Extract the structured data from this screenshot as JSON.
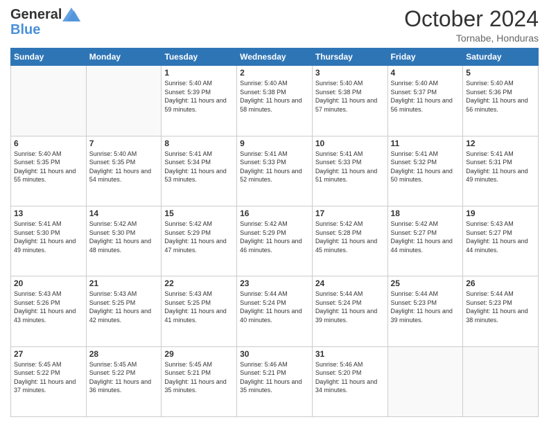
{
  "header": {
    "logo_general": "General",
    "logo_blue": "Blue",
    "month": "October 2024",
    "location": "Tornabe, Honduras"
  },
  "days_of_week": [
    "Sunday",
    "Monday",
    "Tuesday",
    "Wednesday",
    "Thursday",
    "Friday",
    "Saturday"
  ],
  "weeks": [
    [
      {
        "day": "",
        "content": ""
      },
      {
        "day": "",
        "content": ""
      },
      {
        "day": "1",
        "content": "Sunrise: 5:40 AM\nSunset: 5:39 PM\nDaylight: 11 hours and 59 minutes."
      },
      {
        "day": "2",
        "content": "Sunrise: 5:40 AM\nSunset: 5:38 PM\nDaylight: 11 hours and 58 minutes."
      },
      {
        "day": "3",
        "content": "Sunrise: 5:40 AM\nSunset: 5:38 PM\nDaylight: 11 hours and 57 minutes."
      },
      {
        "day": "4",
        "content": "Sunrise: 5:40 AM\nSunset: 5:37 PM\nDaylight: 11 hours and 56 minutes."
      },
      {
        "day": "5",
        "content": "Sunrise: 5:40 AM\nSunset: 5:36 PM\nDaylight: 11 hours and 56 minutes."
      }
    ],
    [
      {
        "day": "6",
        "content": "Sunrise: 5:40 AM\nSunset: 5:35 PM\nDaylight: 11 hours and 55 minutes."
      },
      {
        "day": "7",
        "content": "Sunrise: 5:40 AM\nSunset: 5:35 PM\nDaylight: 11 hours and 54 minutes."
      },
      {
        "day": "8",
        "content": "Sunrise: 5:41 AM\nSunset: 5:34 PM\nDaylight: 11 hours and 53 minutes."
      },
      {
        "day": "9",
        "content": "Sunrise: 5:41 AM\nSunset: 5:33 PM\nDaylight: 11 hours and 52 minutes."
      },
      {
        "day": "10",
        "content": "Sunrise: 5:41 AM\nSunset: 5:33 PM\nDaylight: 11 hours and 51 minutes."
      },
      {
        "day": "11",
        "content": "Sunrise: 5:41 AM\nSunset: 5:32 PM\nDaylight: 11 hours and 50 minutes."
      },
      {
        "day": "12",
        "content": "Sunrise: 5:41 AM\nSunset: 5:31 PM\nDaylight: 11 hours and 49 minutes."
      }
    ],
    [
      {
        "day": "13",
        "content": "Sunrise: 5:41 AM\nSunset: 5:30 PM\nDaylight: 11 hours and 49 minutes."
      },
      {
        "day": "14",
        "content": "Sunrise: 5:42 AM\nSunset: 5:30 PM\nDaylight: 11 hours and 48 minutes."
      },
      {
        "day": "15",
        "content": "Sunrise: 5:42 AM\nSunset: 5:29 PM\nDaylight: 11 hours and 47 minutes."
      },
      {
        "day": "16",
        "content": "Sunrise: 5:42 AM\nSunset: 5:29 PM\nDaylight: 11 hours and 46 minutes."
      },
      {
        "day": "17",
        "content": "Sunrise: 5:42 AM\nSunset: 5:28 PM\nDaylight: 11 hours and 45 minutes."
      },
      {
        "day": "18",
        "content": "Sunrise: 5:42 AM\nSunset: 5:27 PM\nDaylight: 11 hours and 44 minutes."
      },
      {
        "day": "19",
        "content": "Sunrise: 5:43 AM\nSunset: 5:27 PM\nDaylight: 11 hours and 44 minutes."
      }
    ],
    [
      {
        "day": "20",
        "content": "Sunrise: 5:43 AM\nSunset: 5:26 PM\nDaylight: 11 hours and 43 minutes."
      },
      {
        "day": "21",
        "content": "Sunrise: 5:43 AM\nSunset: 5:25 PM\nDaylight: 11 hours and 42 minutes."
      },
      {
        "day": "22",
        "content": "Sunrise: 5:43 AM\nSunset: 5:25 PM\nDaylight: 11 hours and 41 minutes."
      },
      {
        "day": "23",
        "content": "Sunrise: 5:44 AM\nSunset: 5:24 PM\nDaylight: 11 hours and 40 minutes."
      },
      {
        "day": "24",
        "content": "Sunrise: 5:44 AM\nSunset: 5:24 PM\nDaylight: 11 hours and 39 minutes."
      },
      {
        "day": "25",
        "content": "Sunrise: 5:44 AM\nSunset: 5:23 PM\nDaylight: 11 hours and 39 minutes."
      },
      {
        "day": "26",
        "content": "Sunrise: 5:44 AM\nSunset: 5:23 PM\nDaylight: 11 hours and 38 minutes."
      }
    ],
    [
      {
        "day": "27",
        "content": "Sunrise: 5:45 AM\nSunset: 5:22 PM\nDaylight: 11 hours and 37 minutes."
      },
      {
        "day": "28",
        "content": "Sunrise: 5:45 AM\nSunset: 5:22 PM\nDaylight: 11 hours and 36 minutes."
      },
      {
        "day": "29",
        "content": "Sunrise: 5:45 AM\nSunset: 5:21 PM\nDaylight: 11 hours and 35 minutes."
      },
      {
        "day": "30",
        "content": "Sunrise: 5:46 AM\nSunset: 5:21 PM\nDaylight: 11 hours and 35 minutes."
      },
      {
        "day": "31",
        "content": "Sunrise: 5:46 AM\nSunset: 5:20 PM\nDaylight: 11 hours and 34 minutes."
      },
      {
        "day": "",
        "content": ""
      },
      {
        "day": "",
        "content": ""
      }
    ]
  ]
}
